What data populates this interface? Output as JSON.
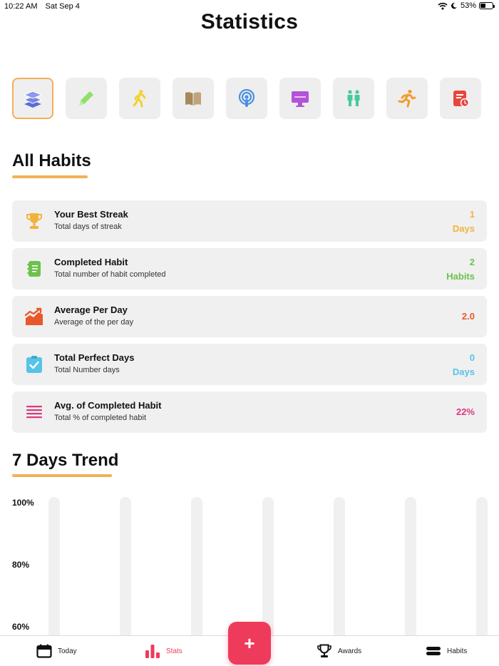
{
  "status": {
    "time": "10:22 AM",
    "date": "Sat Sep 4",
    "battery": "53%"
  },
  "title": "Statistics",
  "categories": [
    {
      "icon": "layers-icon",
      "color": "#5b6bd6",
      "selected": true
    },
    {
      "icon": "pencil-icon",
      "color": "#8ee06b",
      "selected": false
    },
    {
      "icon": "walking-icon",
      "color": "#f3d12e",
      "selected": false
    },
    {
      "icon": "book-icon",
      "color": "#a8885b",
      "selected": false
    },
    {
      "icon": "podcast-icon",
      "color": "#4a90e2",
      "selected": false
    },
    {
      "icon": "monitor-icon",
      "color": "#b253d8",
      "selected": false
    },
    {
      "icon": "people-icon",
      "color": "#46c9a3",
      "selected": false
    },
    {
      "icon": "running-icon",
      "color": "#f29b2e",
      "selected": false
    },
    {
      "icon": "clipboard-clock-icon",
      "color": "#e8453c",
      "selected": false
    }
  ],
  "all_habits": {
    "heading": "All Habits",
    "cards": [
      {
        "icon": "trophy-icon",
        "icon_color": "#f2b33d",
        "title": "Your Best Streak",
        "subtitle": "Total days of streak",
        "value": "1",
        "unit": "Days",
        "value_color": "#f2b33d"
      },
      {
        "icon": "notebook-icon",
        "icon_color": "#6cc24a",
        "title": "Completed Habit",
        "subtitle": "Total number of habit completed",
        "value": "2",
        "unit": "Habits",
        "value_color": "#6cc24a"
      },
      {
        "icon": "trend-chart-icon",
        "icon_color": "#e8582b",
        "title": "Average Per Day",
        "subtitle": "Average of the per day",
        "value": "2.0",
        "unit": "",
        "value_color": "#e8582b"
      },
      {
        "icon": "clipboard-check-icon",
        "icon_color": "#56c3e8",
        "title": "Total Perfect Days",
        "subtitle": "Total Number days",
        "value": "0",
        "unit": "Days",
        "value_color": "#56c3e8"
      },
      {
        "icon": "list-lines-icon",
        "icon_color": "#d83a7f",
        "title": "Avg. of Completed Habit",
        "subtitle": "Total % of completed habit",
        "value": "22%",
        "unit": "",
        "value_color": "#d83a7f"
      }
    ]
  },
  "trend": {
    "heading": "7 Days Trend",
    "y_ticks": [
      "100%",
      "80%",
      "60%"
    ],
    "bar_count": 7
  },
  "chart_data": {
    "type": "bar",
    "title": "7 Days Trend",
    "y_ticks": [
      "100%",
      "80%",
      "60%"
    ],
    "ylim": [
      60,
      100
    ],
    "bars_visible": 7
  },
  "tabs": {
    "today": "Today",
    "stats": "Stats",
    "awards": "Awards",
    "habits": "Habits",
    "add": "+"
  }
}
